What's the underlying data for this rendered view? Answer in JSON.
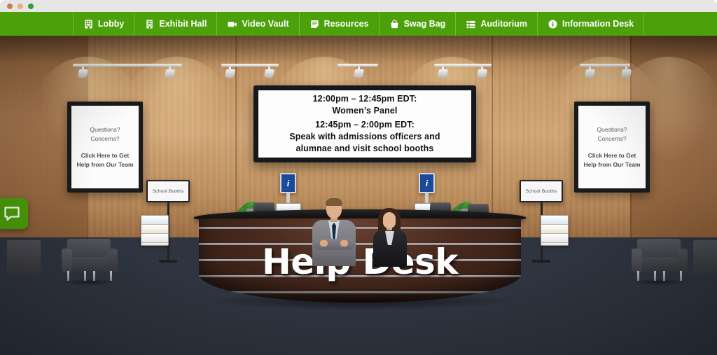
{
  "window": {
    "traffic_lights": [
      "close",
      "minimize",
      "maximize"
    ]
  },
  "nav": {
    "background_color": "#4ca009",
    "divider_color": "#6bbf3d",
    "items": [
      {
        "label": "Lobby",
        "icon": "building-icon"
      },
      {
        "label": "Exhibit Hall",
        "icon": "building-columns-icon"
      },
      {
        "label": "Video Vault",
        "icon": "video-camera-icon"
      },
      {
        "label": "Resources",
        "icon": "document-icon"
      },
      {
        "label": "Swag Bag",
        "icon": "shopping-bag-icon"
      },
      {
        "label": "Auditorium",
        "icon": "list-rows-icon"
      },
      {
        "label": "Information Desk",
        "icon": "info-circle-icon"
      }
    ]
  },
  "scene": {
    "name": "Information Desk virtual lobby",
    "counter_title": "Help Desk",
    "marquee": {
      "lines": [
        "12:00pm – 12:45pm EDT:",
        "Women’s Panel"
      ],
      "lines2": [
        "12:45pm – 2:00pm EDT:",
        "Speak with admissions officers and",
        "alumnae and visit school booths"
      ]
    },
    "posters": [
      {
        "question_line1": "Questions?",
        "question_line2": "Concerns?",
        "cta_line1": "Click Here to Get",
        "cta_line2": "Help from Our Team"
      },
      {
        "question_line1": "Questions?",
        "question_line2": "Concerns?",
        "cta_line1": "Click Here to Get",
        "cta_line2": "Help from Our Team"
      }
    ],
    "booth_signs": [
      {
        "label": "School Booths"
      },
      {
        "label": "School Booths"
      }
    ],
    "kiosks": [
      {
        "glyph": "i",
        "color": "#1b4a9c"
      },
      {
        "glyph": "i",
        "color": "#1b4a9c"
      }
    ],
    "chat": {
      "icon": "chat-bubble-icon",
      "color": "#4ca009"
    }
  },
  "colors": {
    "accent_green": "#4ca009",
    "wall_wood": "#c79a68",
    "floor_slate": "#424a59",
    "counter_wood": "#4a2a1d",
    "kiosk_blue": "#1b4a9c"
  }
}
